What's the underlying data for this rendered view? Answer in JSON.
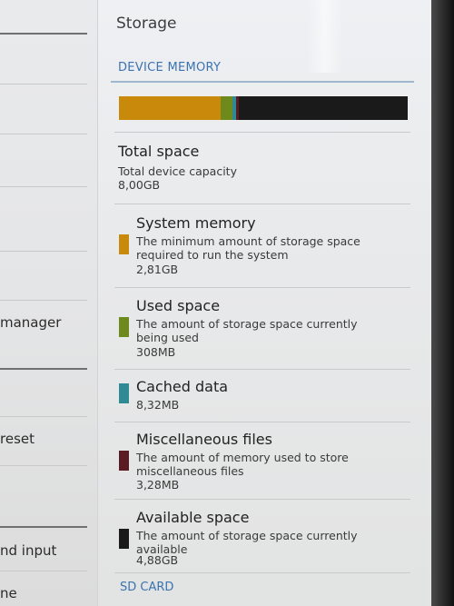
{
  "sidebar": {
    "items": [
      {
        "label": "manager"
      },
      {
        "label": "reset"
      },
      {
        "label": "nd input"
      },
      {
        "label": "ne"
      }
    ]
  },
  "header": {
    "title": "Storage"
  },
  "device_memory": {
    "header": "DEVICE MEMORY",
    "bar_colors": {
      "system": "#c98a0c",
      "used": "#6f8a1c",
      "cached": "#2f8a93",
      "misc": "#5a1c22",
      "available": "#1a1a1a"
    },
    "total": {
      "title": "Total space",
      "subtitle": "Total device capacity",
      "value": "8,00GB"
    },
    "items": [
      {
        "name": "System memory",
        "desc": "The minimum amount of storage space required to run the system",
        "value": "2,81GB",
        "color": "#c98a0c"
      },
      {
        "name": "Used space",
        "desc": "The amount of storage space currently being used",
        "value": "308MB",
        "color": "#6f8a1c"
      },
      {
        "name": "Cached data",
        "desc": "",
        "value": "8,32MB",
        "color": "#2f8a93"
      },
      {
        "name": "Miscellaneous files",
        "desc": "The amount of memory used to store miscellaneous files",
        "value": "3,28MB",
        "color": "#5a1c22"
      },
      {
        "name": "Available space",
        "desc": "The amount of storage space currently available",
        "value": "4,88GB",
        "color": "#1a1a1a"
      }
    ]
  },
  "sd_card": {
    "header": "SD CARD"
  }
}
